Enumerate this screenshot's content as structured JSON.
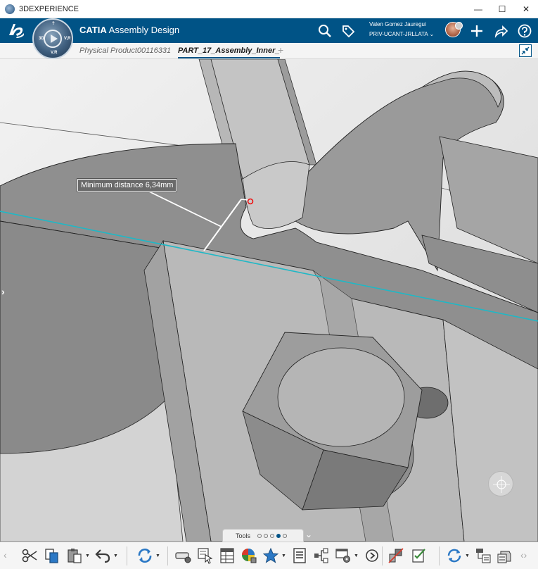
{
  "window": {
    "title": "3DEXPERIENCE",
    "minimize": "—",
    "maximize": "☐",
    "close": "✕"
  },
  "header": {
    "brand": "CATIA",
    "app": "Assembly Design",
    "user_name": "Valen Gomez Jauregui",
    "tenant": "PRIV-UCANT-JRLLATA",
    "tenant_caret": "⌄",
    "compass_labels": [
      "3D",
      "V.R",
      "V,R",
      "?"
    ]
  },
  "tabs": {
    "items": [
      "Physical Product00116331",
      "PART_17_Assembly_Inner_"
    ],
    "add": "+"
  },
  "viewport": {
    "measure_label": "Minimum distance 6,34mm",
    "left_toggle": "›"
  },
  "tools_bar": {
    "label": "Tools",
    "dots": 5,
    "active_dot": 3,
    "expand": "⌄"
  },
  "colors": {
    "header_blue": "#005386",
    "axis_cyan": "#1fb8c6",
    "model_gray": "#a9a9a9"
  },
  "toolbar": {
    "left_nav": "‹",
    "right_nav": "‹›",
    "icons": [
      "scissors-icon",
      "copy-icon",
      "paste-icon",
      "undo-icon",
      "update-icon",
      "drive-settings-icon",
      "select-icon",
      "table-icon",
      "color-globe-icon",
      "favorite-star-icon",
      "list-icon",
      "properties-icon",
      "tree-structure-icon",
      "play-next-icon",
      "clash-icon",
      "checklist-icon",
      "refresh-icon",
      "hierarchy-icon",
      "stack-icon"
    ]
  }
}
